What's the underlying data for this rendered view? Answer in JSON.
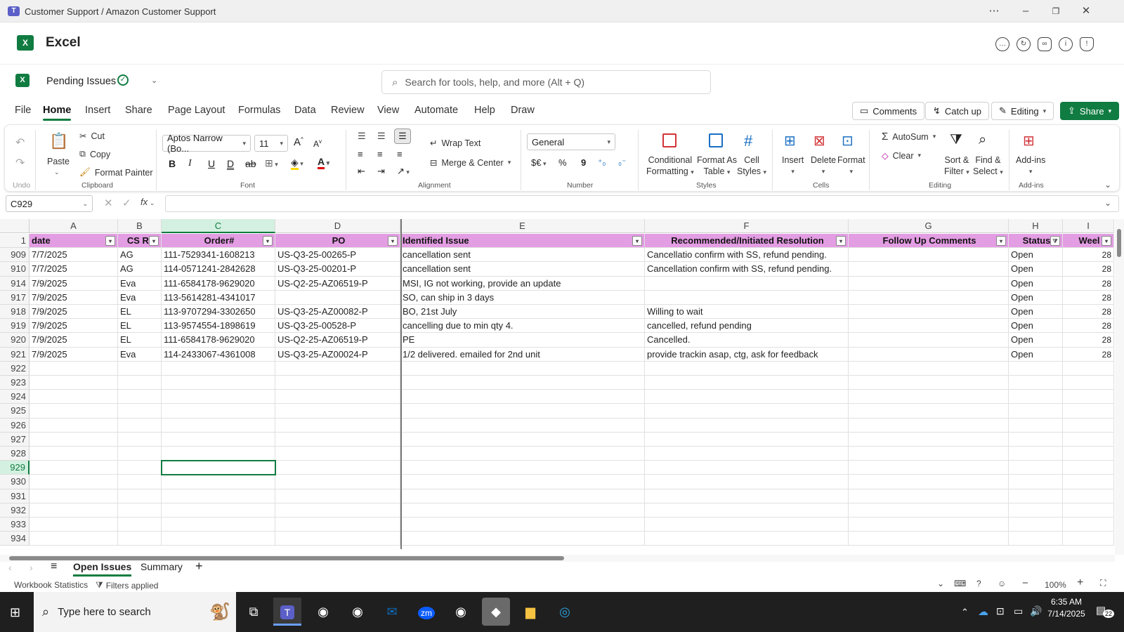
{
  "window": {
    "title": "Customer Support / Amazon Customer Support"
  },
  "app": {
    "name": "Excel"
  },
  "doc": {
    "name": "Pending Issues"
  },
  "search": {
    "placeholder": "Search for tools, help, and more (Alt + Q)"
  },
  "tabs": [
    "File",
    "Home",
    "Insert",
    "Share",
    "Page Layout",
    "Formulas",
    "Data",
    "Review",
    "View",
    "Automate",
    "Help",
    "Draw"
  ],
  "actions": {
    "comments": "Comments",
    "catchup": "Catch up",
    "editing": "Editing",
    "share": "Share"
  },
  "ribbon": {
    "undo": "Undo",
    "clipboard": {
      "paste": "Paste",
      "cut": "Cut",
      "copy": "Copy",
      "format_painter": "Format Painter",
      "label": "Clipboard"
    },
    "font": {
      "name": "Aptos Narrow (Bo...",
      "size": "11",
      "label": "Font"
    },
    "alignment": {
      "wrap": "Wrap Text",
      "merge": "Merge & Center",
      "label": "Alignment"
    },
    "number": {
      "format": "General",
      "label": "Number"
    },
    "styles": {
      "conditional": "Conditional",
      "conditional2": "Formatting",
      "format_as": "Format As",
      "format_as2": "Table",
      "cell": "Cell",
      "cell2": "Styles",
      "label": "Styles"
    },
    "cells": {
      "insert": "Insert",
      "delete": "Delete",
      "format": "Format",
      "label": "Cells"
    },
    "editing": {
      "autosum": "AutoSum",
      "clear": "Clear",
      "sort": "Sort &",
      "sort2": "Filter",
      "find": "Find &",
      "find2": "Select",
      "label": "Editing"
    },
    "addins": {
      "addins": "Add-ins",
      "label": "Add-ins"
    }
  },
  "formula_bar": {
    "name_box": "C929",
    "formula": ""
  },
  "columns": [
    "A",
    "B",
    "C",
    "D",
    "E",
    "F",
    "G",
    "H",
    "I"
  ],
  "table_headers": [
    "date",
    "CS Re",
    "Order#",
    "PO",
    "Identified Issue",
    "Recommended/Initiated Resolution",
    "Follow Up Comments",
    "Status",
    "Weel"
  ],
  "header_row_num": "1",
  "rows": [
    {
      "num": "909",
      "date": "7/7/2025",
      "cs": "AG",
      "order": "111-7529341-1608213",
      "po": "US-Q3-25-00265-P",
      "issue": "cancellation sent",
      "resolution": "Cancellatio confirm with SS, refund pending.",
      "followup": "",
      "status": "Open",
      "week": "28"
    },
    {
      "num": "910",
      "date": "7/7/2025",
      "cs": "AG",
      "order": "114-0571241-2842628",
      "po": "US-Q3-25-00201-P",
      "issue": "cancellation sent",
      "resolution": "Cancellation confirm with SS, refund pending.",
      "followup": "",
      "status": "Open",
      "week": "28"
    },
    {
      "num": "914",
      "date": "7/9/2025",
      "cs": "Eva",
      "order": "111-6584178-9629020",
      "po": "US-Q2-25-AZ06519-P",
      "issue": "MSI, IG not working, provide an update",
      "resolution": "",
      "followup": "",
      "status": "Open",
      "week": "28"
    },
    {
      "num": "917",
      "date": "7/9/2025",
      "cs": "Eva",
      "order": "113-5614281-4341017",
      "po": "",
      "issue": "SO, can ship in 3 days",
      "resolution": "",
      "followup": "",
      "status": "Open",
      "week": "28"
    },
    {
      "num": "918",
      "date": "7/9/2025",
      "cs": "EL",
      "order": "113-9707294-3302650",
      "po": "US-Q3-25-AZ00082-P",
      "issue": "BO, 21st July",
      "resolution": "Willing to wait",
      "followup": "",
      "status": "Open",
      "week": "28"
    },
    {
      "num": "919",
      "date": "7/9/2025",
      "cs": "EL",
      "order": "113-9574554-1898619",
      "po": "US-Q3-25-00528-P",
      "issue": "cancelling due to min qty 4.",
      "resolution": "cancelled, refund pending",
      "followup": "",
      "status": "Open",
      "week": "28"
    },
    {
      "num": "920",
      "date": "7/9/2025",
      "cs": "EL",
      "order": "111-6584178-9629020",
      "po": "US-Q2-25-AZ06519-P",
      "issue": "PE",
      "resolution": "Cancelled.",
      "followup": "",
      "status": "Open",
      "week": "28"
    },
    {
      "num": "921",
      "date": "7/9/2025",
      "cs": "Eva",
      "order": "114-2433067-4361008",
      "po": "US-Q3-25-AZ00024-P",
      "issue": "1/2 delivered. emailed for 2nd unit",
      "resolution": "provide trackin asap, ctg, ask for feedback",
      "followup": "",
      "status": "Open",
      "week": "28"
    }
  ],
  "empty_rows": [
    "922",
    "923",
    "924",
    "925",
    "926",
    "927",
    "928",
    "929",
    "930",
    "931",
    "932",
    "933",
    "934"
  ],
  "sheets": {
    "active": "Open Issues",
    "other": "Summary"
  },
  "status": {
    "stats": "Workbook Statistics",
    "filters": "Filters applied",
    "zoom": "100%"
  },
  "taskbar": {
    "search": "Type here to search",
    "time": "6:35 AM",
    "date": "7/14/2025",
    "notif": "22"
  },
  "colors": {
    "excel_green": "#107c41",
    "header_fill": "#e39de3",
    "teams": "#5b5fc7"
  }
}
